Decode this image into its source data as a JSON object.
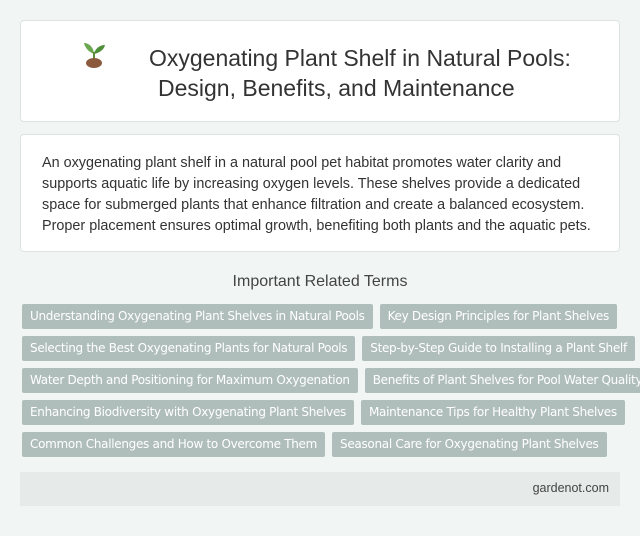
{
  "header": {
    "icon": "seedling-icon",
    "title_line1": "Oxygenating Plant Shelf in Natural Pools:",
    "title_line2": "Design, Benefits, and Maintenance"
  },
  "description": "An oxygenating plant shelf in a natural pool pet habitat promotes water clarity and supports aquatic life by increasing oxygen levels. These shelves provide a dedicated space for submerged plants that enhance filtration and create a balanced ecosystem. Proper placement ensures optimal growth, benefiting both plants and the aquatic pets.",
  "related": {
    "heading": "Important Related Terms",
    "tags": [
      "Understanding Oxygenating Plant Shelves in Natural Pools",
      "Key Design Principles for Plant Shelves",
      "Selecting the Best Oxygenating Plants for Natural Pools",
      "Step-by-Step Guide to Installing a Plant Shelf",
      "Water Depth and Positioning for Maximum Oxygenation",
      "Benefits of Plant Shelves for Pool Water Quality",
      "Enhancing Biodiversity with Oxygenating Plant Shelves",
      "Maintenance Tips for Healthy Plant Shelves",
      "Common Challenges and How to Overcome Them",
      "Seasonal Care for Oxygenating Plant Shelves"
    ]
  },
  "footer": {
    "site": "gardenot.com"
  },
  "colors": {
    "background": "#f1f6f4",
    "tag_bg": "#b0bebb",
    "footer_bg": "#e6ebe9"
  }
}
